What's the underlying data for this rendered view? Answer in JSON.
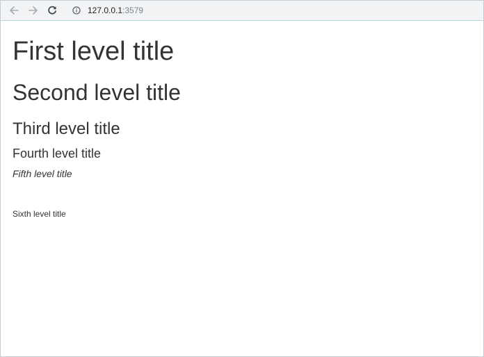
{
  "browser": {
    "url_host": "127.0.0.1",
    "url_port": ":3579",
    "icons": {
      "back": "arrow-left-icon",
      "forward": "arrow-right-icon",
      "reload": "reload-icon",
      "site_info": "info-icon"
    }
  },
  "page": {
    "headings": {
      "h1": "First level title",
      "h2": "Second level title",
      "h3": "Third level title",
      "h4": "Fourth level title",
      "h5": "Fifth level title",
      "h6": "Sixth level title"
    }
  },
  "colors": {
    "text": "#333333",
    "toolbar_bg": "#f1f3f4",
    "url_port": "#80868b"
  }
}
